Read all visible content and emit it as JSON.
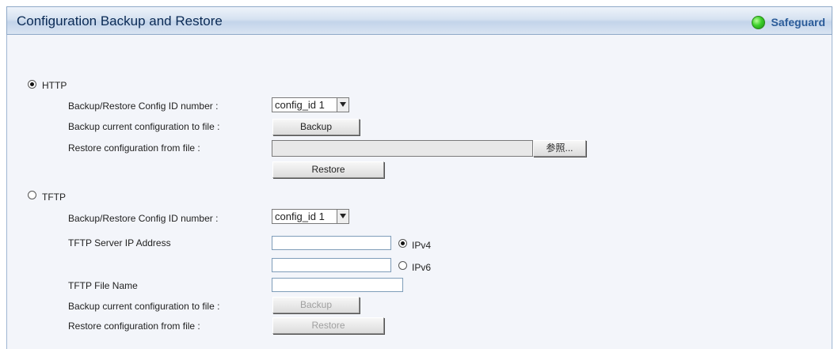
{
  "header": {
    "title": "Configuration Backup and Restore",
    "safeguard_label": "Safeguard"
  },
  "http": {
    "mode_label": "HTTP",
    "selected": true,
    "config_id_label": "Backup/Restore Config ID number :",
    "config_id_value": "config_id 1",
    "backup_label": "Backup current configuration to file :",
    "backup_button": "Backup",
    "restore_label": "Restore configuration from file :",
    "browse_button": "参照...",
    "restore_button": "Restore"
  },
  "tftp": {
    "mode_label": "TFTP",
    "selected": false,
    "config_id_label": "Backup/Restore Config ID number :",
    "config_id_value": "config_id 1",
    "server_ip_label": "TFTP Server IP Address",
    "ipv4_label": "IPv4",
    "ipv6_label": "IPv6",
    "file_name_label": "TFTP File Name",
    "backup_label": "Backup current configuration to file :",
    "backup_button": "Backup",
    "restore_label": "Restore configuration from file :",
    "restore_button": "Restore"
  }
}
